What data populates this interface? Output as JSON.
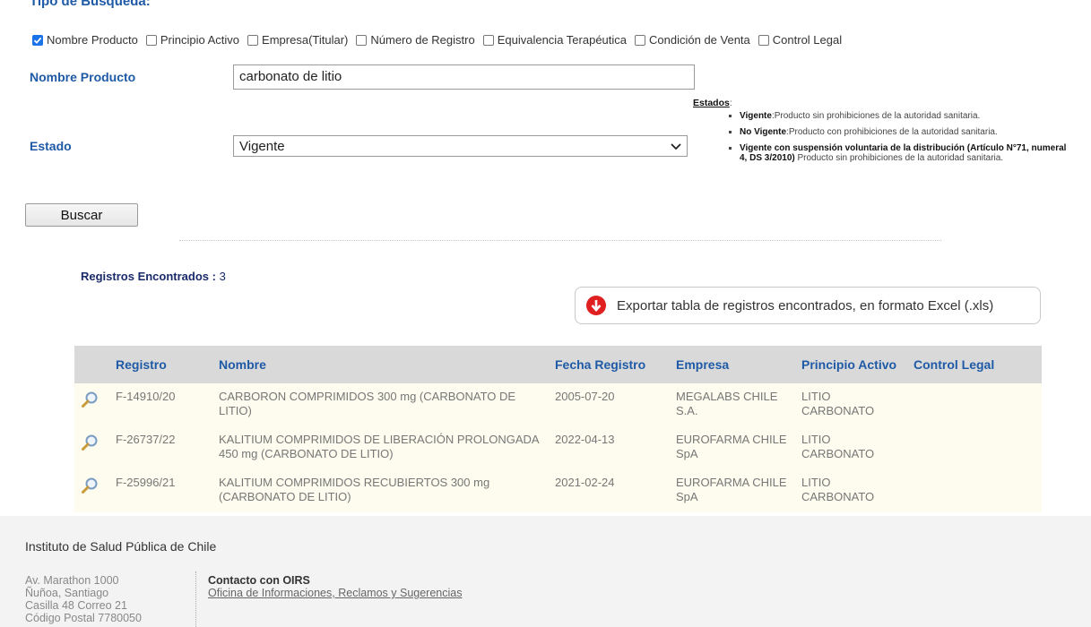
{
  "search": {
    "section_title": "Tipo de Búsqueda:",
    "types": [
      {
        "label": "Nombre Producto",
        "checked": true
      },
      {
        "label": "Principio Activo",
        "checked": false
      },
      {
        "label": "Empresa(Titular)",
        "checked": false
      },
      {
        "label": "Número de Registro",
        "checked": false
      },
      {
        "label": "Equivalencia Terapéutica",
        "checked": false
      },
      {
        "label": "Condición de Venta",
        "checked": false
      },
      {
        "label": "Control Legal",
        "checked": false
      }
    ],
    "product_label": "Nombre Producto",
    "product_value": "carbonato de litio",
    "status_label": "Estado",
    "status_value": "Vigente",
    "search_button": "Buscar"
  },
  "estados": {
    "title": "Estados",
    "items": [
      {
        "term": "Vigente",
        "desc": ":Producto sin prohibiciones de la autoridad sanitaria."
      },
      {
        "term": "No Vigente",
        "desc": ":Producto con prohibiciones de la autoridad sanitaria."
      },
      {
        "term": "Vigente con suspensión voluntaria de la distribución (Artículo N°71, numeral 4, DS 3/2010)",
        "desc": " Producto sin prohibiciones de la autoridad sanitaria."
      }
    ]
  },
  "results": {
    "count_label": "Registros Encontrados :",
    "count": "3",
    "export_label": "Exportar tabla de registros encontrados, en formato Excel (.xls)",
    "columns": [
      "Registro",
      "Nombre",
      "Fecha Registro",
      "Empresa",
      "Principio Activo",
      "Control Legal"
    ],
    "rows": [
      {
        "registro": "F-14910/20",
        "nombre": "CARBORON COMPRIMIDOS 300 mg (CARBONATO DE LITIO)",
        "fecha": "2005-07-20",
        "empresa": "MEGALABS CHILE S.A.",
        "principio": "LITIO CARBONATO",
        "control": ""
      },
      {
        "registro": "F-26737/22",
        "nombre": "KALITIUM COMPRIMIDOS DE LIBERACIÓN PROLONGADA 450 mg (CARBONATO DE LITIO)",
        "fecha": "2022-04-13",
        "empresa": "EUROFARMA CHILE SpA",
        "principio": "LITIO CARBONATO",
        "control": ""
      },
      {
        "registro": "F-25996/21",
        "nombre": "KALITIUM COMPRIMIDOS RECUBIERTOS 300 mg (CARBONATO DE LITIO)",
        "fecha": "2021-02-24",
        "empresa": "EUROFARMA CHILE SpA",
        "principio": "LITIO CARBONATO",
        "control": ""
      }
    ]
  },
  "footer": {
    "institute": "Instituto de Salud Pública de Chile",
    "address": [
      "Av. Marathon 1000",
      "Ñuñoa, Santiago",
      "Casilla 48 Correo 21",
      "Código Postal 7780050"
    ],
    "contact_title": "Contacto con OIRS",
    "contact_link": "Oficina de Informaciones, Reclamos y Sugerencias"
  },
  "colors": {
    "accent": "#1f5aa6",
    "row_bg": "#fdfcee",
    "header_bg": "#d9d9d9",
    "export_icon": "#e02020"
  }
}
